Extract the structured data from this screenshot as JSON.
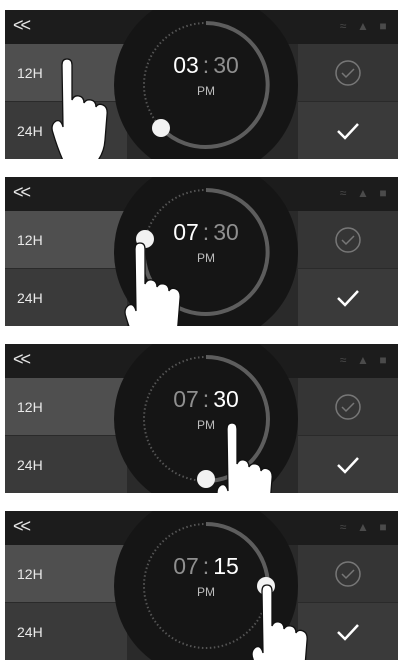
{
  "panels": [
    {
      "back_label": "<<",
      "btn_12h": "12H",
      "btn_24h": "24H",
      "hour": "03",
      "minute": "30",
      "separator": ":",
      "ampm": "PM",
      "active": "hour"
    },
    {
      "back_label": "<<",
      "btn_12h": "12H",
      "btn_24h": "24H",
      "hour": "07",
      "minute": "30",
      "separator": ":",
      "ampm": "PM",
      "active": "hour"
    },
    {
      "back_label": "<<",
      "btn_12h": "12H",
      "btn_24h": "24H",
      "hour": "07",
      "minute": "30",
      "separator": ":",
      "ampm": "PM",
      "active": "minute"
    },
    {
      "back_label": "<<",
      "btn_12h": "12H",
      "btn_24h": "24H",
      "hour": "07",
      "minute": "15",
      "separator": ":",
      "ampm": "PM",
      "active": "minute"
    }
  ],
  "icons": {
    "back": "double-chevron-left-icon",
    "status": [
      "steam-icon",
      "thermometer-icon",
      "door-icon"
    ],
    "confirm_outline": "check-circle-icon",
    "confirm": "check-icon"
  },
  "colors": {
    "panel_bg": "#2a2a2a",
    "topbar_bg": "#1c1c1c",
    "button_active": "#4f4f4f",
    "dial_track": "#8f8f8f"
  }
}
